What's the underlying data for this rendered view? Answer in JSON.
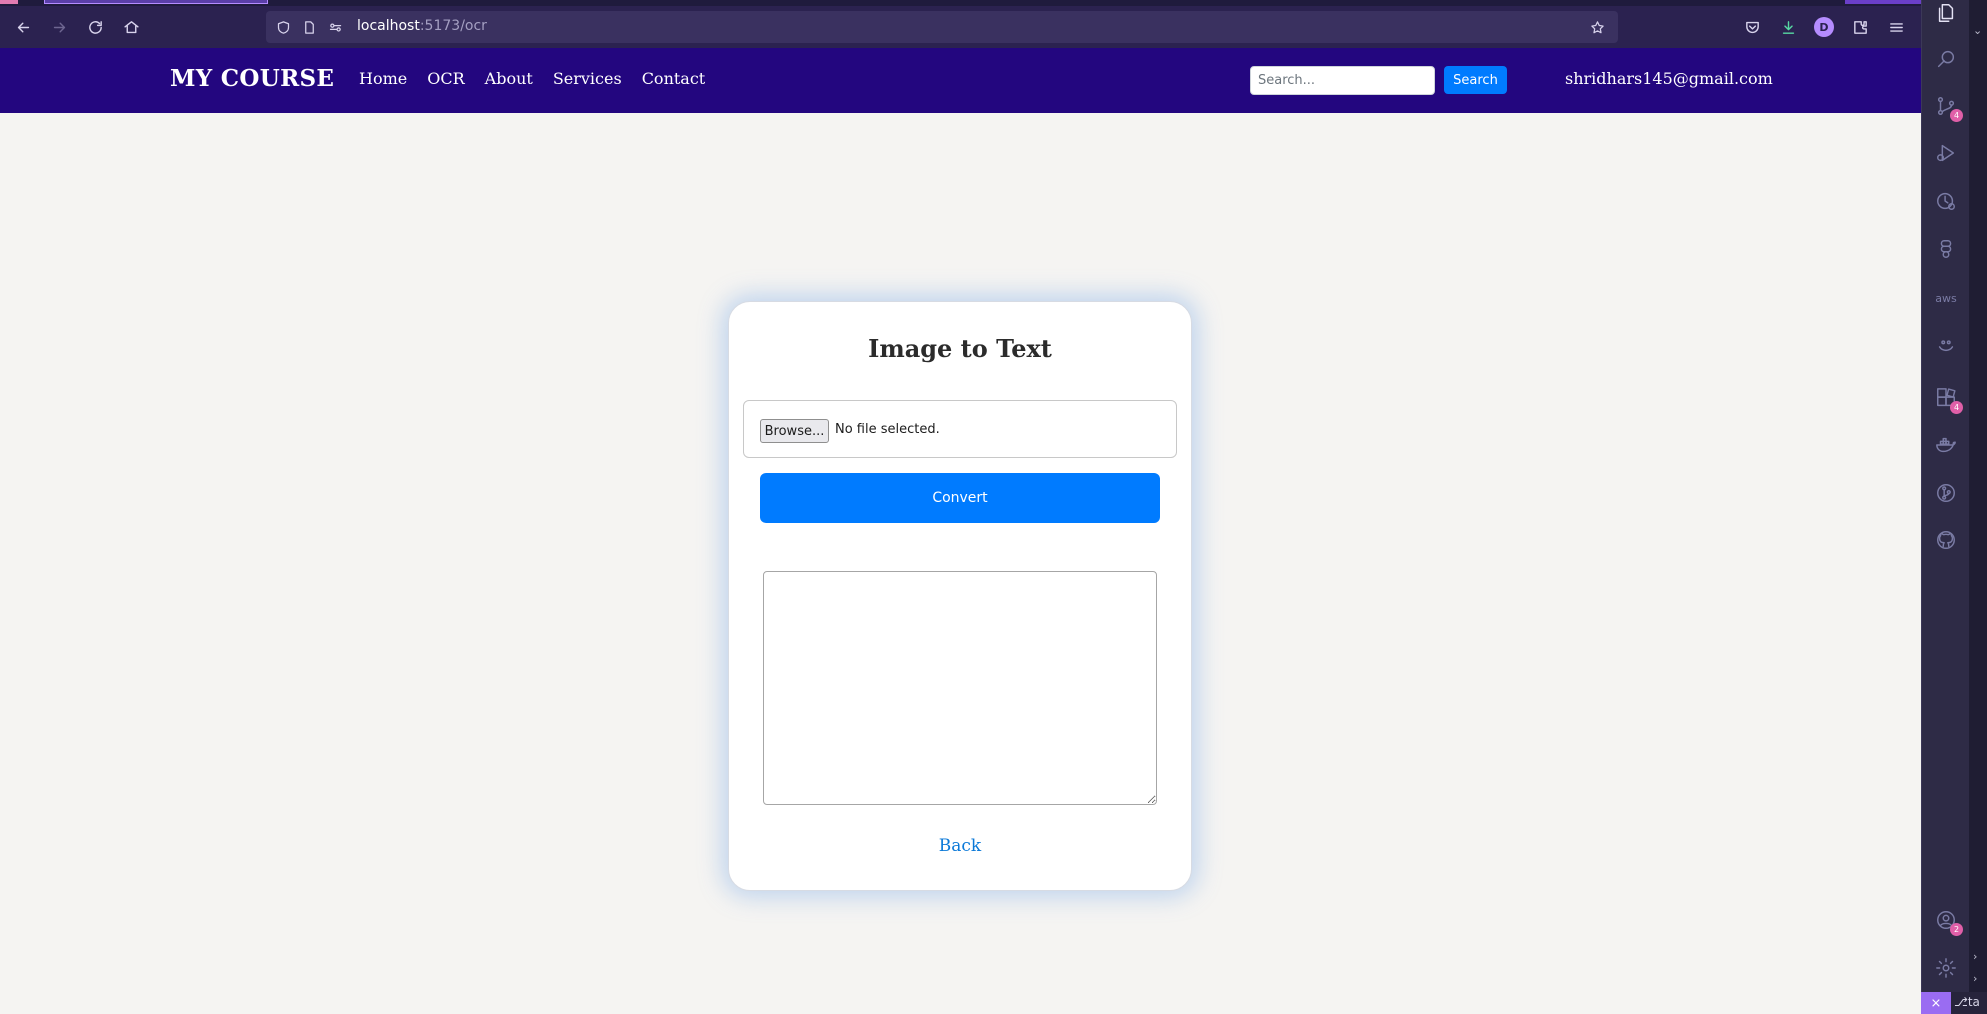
{
  "browser": {
    "url_host": "localhost",
    "url_path": ":5173/ocr",
    "profile_initial": "D"
  },
  "navbar": {
    "brand": "MY COURSE",
    "links": [
      "Home",
      "OCR",
      "About",
      "Services",
      "Contact"
    ],
    "search_placeholder": "Search...",
    "search_button": "Search",
    "user_email": "shridhars145@gmail.com",
    "background_color": "#23067f"
  },
  "ocr_card": {
    "title": "Image to Text",
    "browse_button": "Browse...",
    "file_status": "No file selected.",
    "convert_button": "Convert",
    "result_text": "",
    "back_link": "Back",
    "accent_color": "#007bff"
  },
  "activity_bar": {
    "items": [
      {
        "icon": "files-icon",
        "badge": ""
      },
      {
        "icon": "search-icon",
        "badge": ""
      },
      {
        "icon": "source-control-icon",
        "badge": "4"
      },
      {
        "icon": "run-debug-icon",
        "badge": ""
      },
      {
        "icon": "timeline-icon",
        "badge": ""
      },
      {
        "icon": "figma-icon",
        "badge": ""
      },
      {
        "icon": "aws-icon",
        "badge": ""
      },
      {
        "icon": "smiley-icon",
        "badge": ""
      },
      {
        "icon": "extensions-icon",
        "badge": "4"
      },
      {
        "icon": "docker-icon",
        "badge": ""
      },
      {
        "icon": "git-graph-icon",
        "badge": ""
      },
      {
        "icon": "github-icon",
        "badge": ""
      },
      {
        "icon": "accounts-icon",
        "badge": "2"
      },
      {
        "icon": "settings-gear-icon",
        "badge": ""
      }
    ],
    "aws_label": "aws",
    "status_branch_text": "ta"
  }
}
